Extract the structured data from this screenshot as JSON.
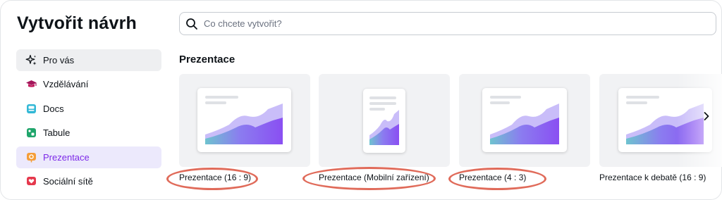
{
  "dialog": {
    "title": "Vytvořit návrh"
  },
  "search": {
    "placeholder": "Co chcete vytvořit?",
    "value": ""
  },
  "sidebar": {
    "items": [
      {
        "label": "Pro vás",
        "icon": "sparkle-icon",
        "state": "hover"
      },
      {
        "label": "Vzdělávání",
        "icon": "graduation-cap-icon",
        "state": ""
      },
      {
        "label": "Docs",
        "icon": "docs-icon",
        "state": ""
      },
      {
        "label": "Tabule",
        "icon": "whiteboard-icon",
        "state": ""
      },
      {
        "label": "Prezentace",
        "icon": "presentation-icon",
        "state": "active"
      },
      {
        "label": "Sociální sítě",
        "icon": "heart-icon",
        "state": ""
      }
    ]
  },
  "section": {
    "title": "Prezentace"
  },
  "templates": [
    {
      "label": "Prezentace (16 : 9)",
      "aspect": "16:9",
      "highlighted": true
    },
    {
      "label": "Prezentace (Mobilní zařízení)",
      "aspect": "mobile",
      "highlighted": true
    },
    {
      "label": "Prezentace (4 : 3)",
      "aspect": "4:3",
      "highlighted": true
    },
    {
      "label": "Prezentace k debatě (16 : 9)",
      "aspect": "16:9",
      "highlighted": false
    }
  ],
  "colors": {
    "accent": "#7d2ae8",
    "active_bg": "#ece9fc",
    "hover_bg": "#eeeff1",
    "highlight_ring": "#e06b5a"
  }
}
